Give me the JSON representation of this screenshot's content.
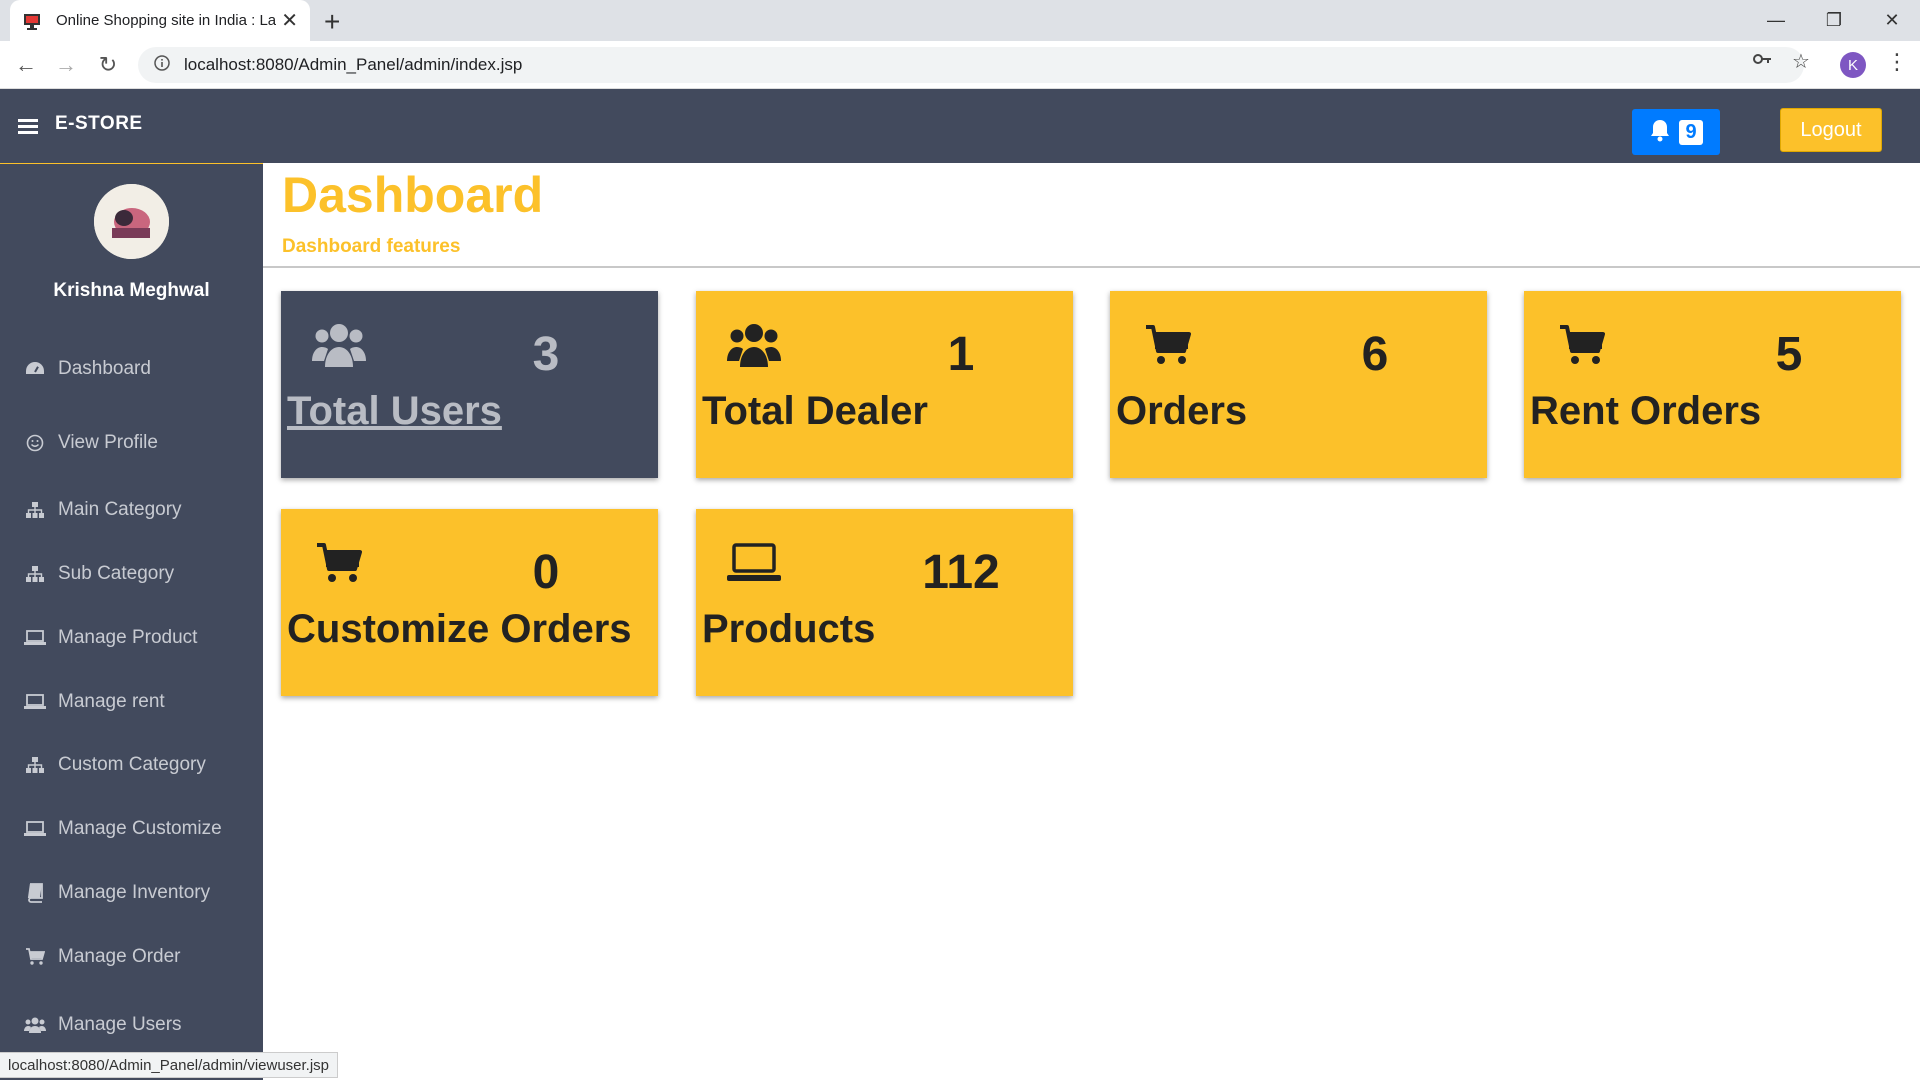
{
  "browser": {
    "tab_title": "Online Shopping site in India : La",
    "url": "localhost:8080/Admin_Panel/admin/index.jsp",
    "profile_initial": "K",
    "status_url": "localhost:8080/Admin_Panel/admin/viewuser.jsp"
  },
  "header": {
    "brand": "E-STORE",
    "notification_count": "9",
    "logout_label": "Logout"
  },
  "sidebar": {
    "user_name": "Krishna Meghwal",
    "items": [
      {
        "label": "Dashboard",
        "icon": "tachometer-icon"
      },
      {
        "label": "View Profile",
        "icon": "smile-icon"
      },
      {
        "label": "Main Category",
        "icon": "sitemap-icon"
      },
      {
        "label": "Sub Category",
        "icon": "sitemap-icon"
      },
      {
        "label": "Manage Product",
        "icon": "laptop-icon"
      },
      {
        "label": "Manage rent",
        "icon": "laptop-icon"
      },
      {
        "label": "Custom Category",
        "icon": "sitemap-icon"
      },
      {
        "label": "Manage Customize",
        "icon": "laptop-icon"
      },
      {
        "label": "Manage Inventory",
        "icon": "book-icon"
      },
      {
        "label": "Manage Order",
        "icon": "cart-icon"
      },
      {
        "label": "Manage Users",
        "icon": "users-icon"
      }
    ]
  },
  "main": {
    "title": "Dashboard",
    "subtitle": "Dashboard features",
    "cards": [
      {
        "value": "3",
        "label": "Total Users",
        "icon": "users-icon",
        "style": "dark"
      },
      {
        "value": "1",
        "label": "Total Dealer",
        "icon": "users-icon",
        "style": "yellow"
      },
      {
        "value": "6",
        "label": "Orders",
        "icon": "cart-icon",
        "style": "yellow"
      },
      {
        "value": "5",
        "label": "Rent Orders",
        "icon": "cart-icon",
        "style": "yellow"
      },
      {
        "value": "0",
        "label": "Customize Orders",
        "icon": "cart-icon",
        "style": "yellow"
      },
      {
        "value": "112",
        "label": "Products",
        "icon": "laptop-icon",
        "style": "yellow"
      }
    ]
  },
  "colors": {
    "header_bg": "#424a5d",
    "accent_yellow": "#fcc12a",
    "notify_blue": "#007bff"
  }
}
